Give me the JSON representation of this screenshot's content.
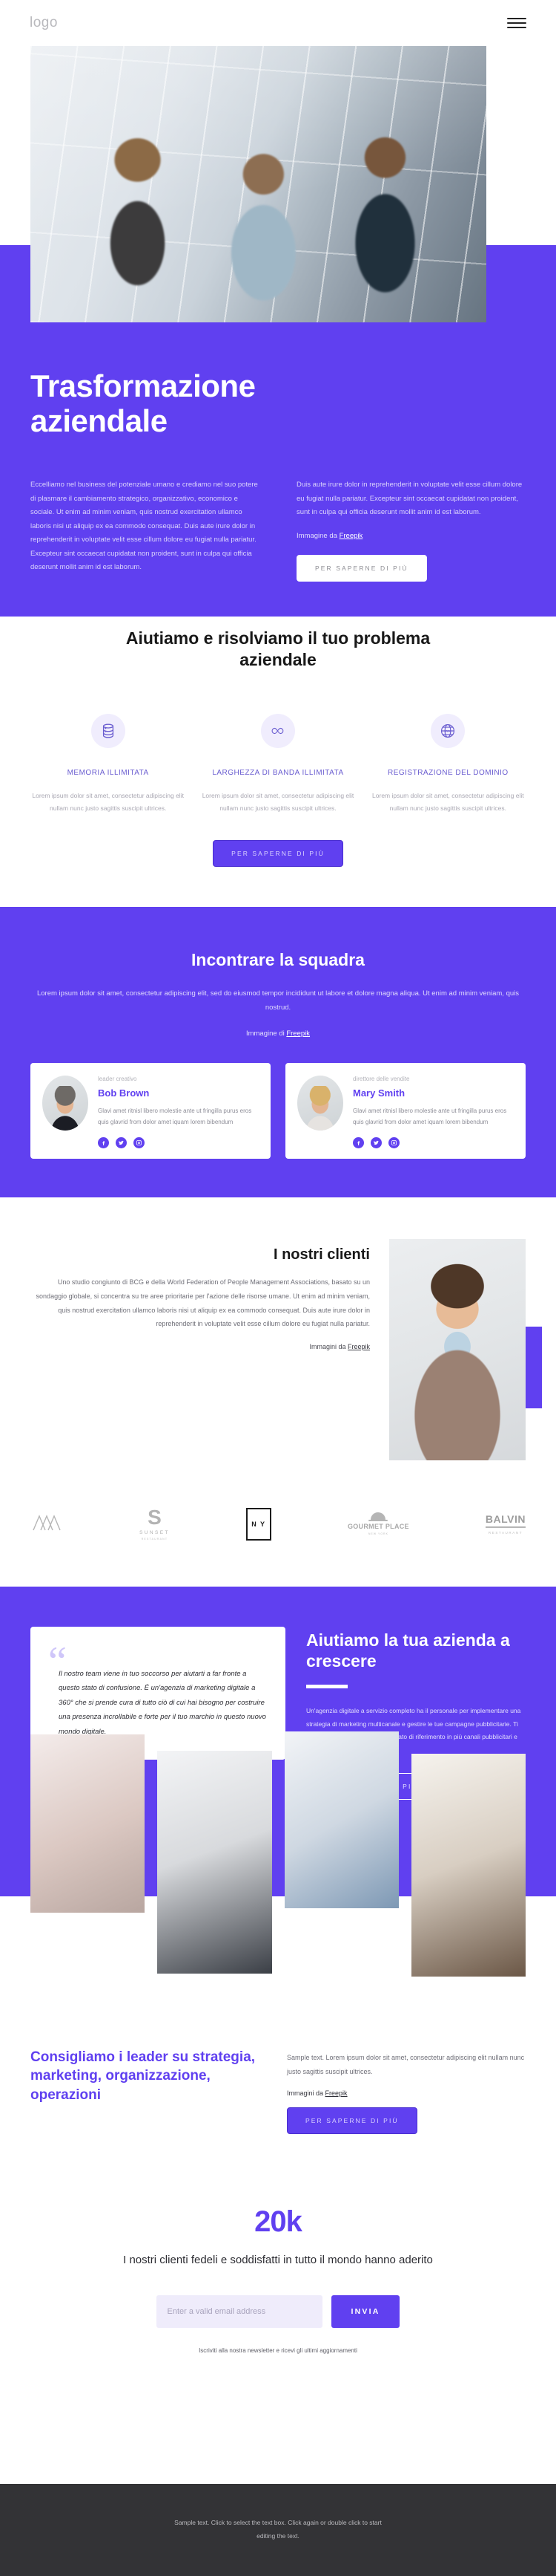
{
  "header": {
    "logo": "logo",
    "menu_label": "menu"
  },
  "hero": {
    "title": "Trasformazione aziendale",
    "paragraph_left": "Eccelliamo nel business del potenziale umano e crediamo nel suo potere di plasmare il cambiamento strategico, organizzativo, economico e sociale. Ut enim ad minim veniam, quis nostrud exercitation ullamco laboris nisi ut aliquip ex ea commodo consequat. Duis aute irure dolor in reprehenderit in voluptate velit esse cillum dolore eu fugiat nulla pariatur. Excepteur sint occaecat cupidatat non proident, sunt in culpa qui officia deserunt mollit anim id est laborum.",
    "paragraph_right": "Duis aute irure dolor in reprehenderit in voluptate velit esse cillum dolore eu fugiat nulla pariatur. Excepteur sint occaecat cupidatat non proident, sunt in culpa qui officia deserunt mollit anim id est laborum.",
    "credit_prefix": "Immagine da ",
    "credit_link": "Freepik",
    "cta": "PER SAPERNE DI PIÙ"
  },
  "services": {
    "title": "Aiutiamo e risolviamo il tuo problema aziendale",
    "cta": "PER SAPERNE DI PIÙ",
    "items": [
      {
        "icon": "database-icon",
        "title": "MEMORIA ILLIMITATA",
        "desc": "Lorem ipsum dolor sit amet, consectetur adipiscing elit nullam nunc justo sagittis suscipit ultrices."
      },
      {
        "icon": "infinity-icon",
        "title": "LARGHEZZA DI BANDA ILLIMITATA",
        "desc": "Lorem ipsum dolor sit amet, consectetur adipiscing elit nullam nunc justo sagittis suscipit ultrices."
      },
      {
        "icon": "globe-www-icon",
        "title": "REGISTRAZIONE DEL DOMINIO",
        "desc": "Lorem ipsum dolor sit amet, consectetur adipiscing elit nullam nunc justo sagittis suscipit ultrices."
      }
    ]
  },
  "team": {
    "title": "Incontrare la squadra",
    "paragraph": "Lorem ipsum dolor sit amet, consectetur adipiscing elit, sed do eiusmod tempor incididunt ut labore et dolore magna aliqua. Ut enim ad minim veniam, quis nostrud.",
    "credit_prefix": "Immagine di ",
    "credit_link": "Freepik",
    "members": [
      {
        "role": "leader creativo",
        "name": "Bob Brown",
        "bio": "Glavi amet ritnisl libero molestie ante ut fringilla purus eros quis glavrid from dolor amet iquam lorem bibendum"
      },
      {
        "role": "direttore delle vendite",
        "name": "Mary Smith",
        "bio": "Glavi amet ritnisl libero molestie ante ut fringilla purus eros quis glavrid from dolor amet iquam lorem bibendum"
      }
    ],
    "social_icons": [
      "facebook-icon",
      "twitter-icon",
      "instagram-icon"
    ]
  },
  "clients": {
    "title": "I nostri clienti",
    "paragraph": "Uno studio congiunto di BCG e della World Federation of People Management Associations, basato su un sondaggio globale, si concentra su tre aree prioritarie per l'azione delle risorse umane. Ut enim ad minim veniam, quis nostrud exercitation ullamco laboris nisi ut aliquip ex ea commodo consequat. Duis aute irure dolor in reprehenderit in voluptate velit esse cillum dolore eu fugiat nulla pariatur.",
    "credit_prefix": "Immagini da ",
    "credit_link": "Freepik"
  },
  "logos": [
    {
      "name": "mountain-logo",
      "label": ""
    },
    {
      "name": "sunset-logo",
      "mark": "S",
      "label": "SUNSET",
      "sub": "RESTAURANT"
    },
    {
      "name": "ny-logo",
      "label": "N Y"
    },
    {
      "name": "gourmet-place-logo",
      "label": "GOURMET PLACE",
      "sub": "NEW YORK"
    },
    {
      "name": "balvin-logo",
      "label": "BALVIN",
      "sub": "RESTAURANT"
    }
  ],
  "growth": {
    "quote": "Il nostro team viene in tuo soccorso per aiutarti a far fronte a questo stato di confusione. È un'agenzia di marketing digitale a 360° che si prende cura di tutto ciò di cui hai bisogno per costruire una presenza incrollabile e forte per il tuo marchio in questo nuovo mondo digitale.",
    "title": "Aiutiamo la tua azienda a crescere",
    "paragraph": "Un'agenzia digitale a servizio completo ha il personale per implementare una strategia di marketing multicanale e gestire le tue campagne pubblicitarie. Ti aiutano a raggiungere il tuo mercato di riferimento in più canali pubblicitari e più dispositivi.",
    "cta": "PER SAPERNE DI PIÙ"
  },
  "advise": {
    "title": "Consigliamo i leader su strategia, marketing, organizzazione, operazioni",
    "paragraph": "Sample text. Lorem ipsum dolor sit amet, consectetur adipiscing elit nullam nunc justo sagittis suscipit ultrices.",
    "credit_prefix": "Immagini da ",
    "credit_link": "Freepik",
    "cta": "PER SAPERNE DI PIÙ"
  },
  "stats": {
    "number": "20k",
    "subtitle": "I nostri clienti fedeli e soddisfatti in tutto il mondo hanno aderito",
    "email_placeholder": "Enter a valid email address",
    "submit_label": "INVIA",
    "note": "Iscriviti alla nostra newsletter e ricevi gli ultimi aggiornamenti"
  },
  "footer": {
    "text": "Sample text. Click to select the text box. Click again or double click to start editing the text."
  },
  "colors": {
    "accent": "#6040f0",
    "dark": "#333336",
    "soft_accent_bg": "#f0edfd"
  }
}
